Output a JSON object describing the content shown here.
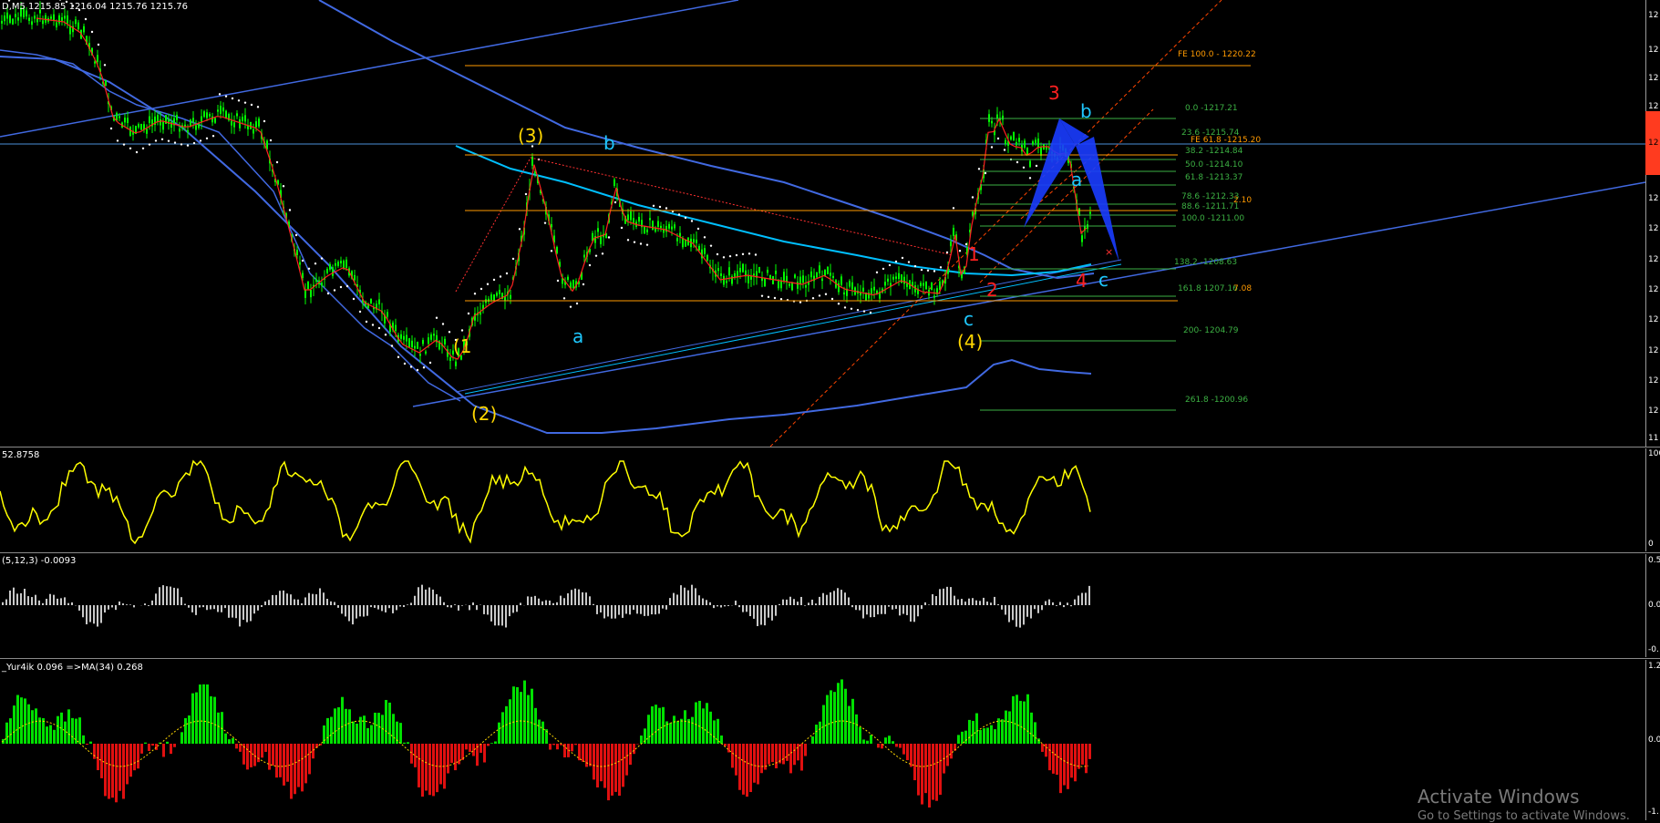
{
  "main": {
    "header": "D,M5  1215.85 1216.04 1215.76 1215.76",
    "price_ticks": [
      "12",
      "12",
      "12",
      "12",
      "12",
      "12",
      "12",
      "12",
      "12",
      "12",
      "12",
      "12",
      "12",
      "12",
      "11"
    ],
    "current_price_tag": "12"
  },
  "wave_labels": [
    {
      "text": "3",
      "color": "#ff2020"
    },
    {
      "text": "b",
      "color": "#1ec8ff"
    },
    {
      "text": "(3)",
      "color": "#ffd700"
    },
    {
      "text": "b",
      "color": "#1ec8ff"
    },
    {
      "text": "a",
      "color": "#1ec8ff"
    },
    {
      "text": "1",
      "color": "#ff2020"
    },
    {
      "text": "2",
      "color": "#ff2020"
    },
    {
      "text": "4",
      "color": "#ff2020"
    },
    {
      "text": "c",
      "color": "#1ec8ff"
    },
    {
      "text": "a",
      "color": "#1ec8ff"
    },
    {
      "text": "c",
      "color": "#1ec8ff"
    },
    {
      "text": "(4)",
      "color": "#ffd700"
    },
    {
      "text": "(1",
      "color": "#ffd700"
    },
    {
      "text": "(2)",
      "color": "#ffd700"
    }
  ],
  "fib_levels": [
    {
      "text": "FE 100.0 - 1220.22",
      "color": "#ff9a00"
    },
    {
      "text": "0.0 -1217.21",
      "color": "#3cb043"
    },
    {
      "text": "23.6 -1215.74",
      "color": "#3cb043"
    },
    {
      "text": "FE 61.8 -1215.20",
      "color": "#ff9a00"
    },
    {
      "text": "38.2 -1214.84",
      "color": "#3cb043"
    },
    {
      "text": "50.0 -1214.10",
      "color": "#3cb043"
    },
    {
      "text": "61.8 -1213.37",
      "color": "#3cb043"
    },
    {
      "text": "78.6 -1212.33",
      "color": "#3cb043"
    },
    {
      "text": "2.10",
      "color": "#ff9a00"
    },
    {
      "text": "88.6 -1211.71",
      "color": "#3cb043"
    },
    {
      "text": "100.0 -1211.00",
      "color": "#3cb043"
    },
    {
      "text": "138.2 -1208.63",
      "color": "#3cb043"
    },
    {
      "text": "161.8 1207.16",
      "color": "#3cb043"
    },
    {
      "text": "7.08",
      "color": "#ff9a00"
    },
    {
      "text": "200- 1204.79",
      "color": "#3cb043"
    },
    {
      "text": "261.8 -1200.96",
      "color": "#3cb043"
    }
  ],
  "stoch": {
    "header": "52.8758",
    "ticks": [
      "100",
      "0"
    ]
  },
  "macd": {
    "header": "(5,12,3) -0.0093",
    "ticks": [
      "0.5",
      "0.0",
      "-0."
    ]
  },
  "histo": {
    "header": "_Yur4ik 0.096 =>MA(34) 0.268",
    "ticks": [
      "1.2",
      "0.0",
      "-1."
    ]
  },
  "watermark": {
    "line1": "Activate Windows",
    "line2": "Go to Settings to activate Windows."
  },
  "colors": {
    "bull_bar": "#00ff00",
    "bear_bar": "#ff2020",
    "oscillator": "#ffff00",
    "ma_blue": "#4169e1",
    "ma_cyan": "#00bfff",
    "fib_green": "#3cb043",
    "fe_orange": "#ff9a00"
  }
}
